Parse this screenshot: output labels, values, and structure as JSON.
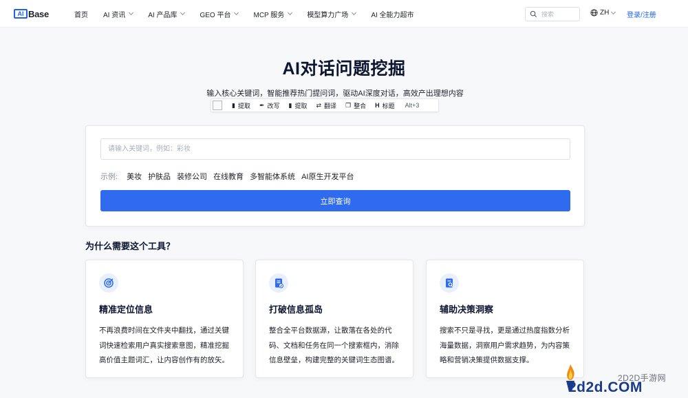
{
  "nav": {
    "logo_mark": "AI",
    "logo_text": "Base",
    "menu": [
      {
        "label": "首页",
        "has_dropdown": false
      },
      {
        "label": "AI 资讯",
        "has_dropdown": true
      },
      {
        "label": "AI 产品库",
        "has_dropdown": true
      },
      {
        "label": "GEO 平台",
        "has_dropdown": true
      },
      {
        "label": "MCP 服务",
        "has_dropdown": true
      },
      {
        "label": "模型算力广场",
        "has_dropdown": true
      },
      {
        "label": "AI 全能力超市",
        "has_dropdown": false
      }
    ],
    "search_placeholder": "搜索",
    "lang": "ZH",
    "login": "登录/注册"
  },
  "hero": {
    "title": "AI对话问题挖掘",
    "subtitle": "输入核心关键词，智能推荐热门提问词，驱动AI深度对话，高效产出理想内容"
  },
  "toolbar": {
    "items": [
      {
        "icon": "document-icon",
        "label": "提取"
      },
      {
        "icon": "pen-icon",
        "label": "改写"
      },
      {
        "icon": "document-icon",
        "label": "提取"
      },
      {
        "icon": "translate-icon",
        "label": "翻译"
      },
      {
        "icon": "merge-icon",
        "label": "整合"
      },
      {
        "icon": "heading-icon",
        "label": "标题"
      }
    ],
    "shortcut": "Alt+3"
  },
  "query": {
    "placeholder": "请输入关键词，例如：彩妆",
    "examples_label": "示例:",
    "examples": [
      "美妆",
      "护肤品",
      "装修公司",
      "在线教育",
      "多智能体系统",
      "AI原生开发平台"
    ],
    "submit_label": "立即查询"
  },
  "why": {
    "title": "为什么需要这个工具？",
    "features": [
      {
        "icon": "target-icon",
        "title": "精准定位信息",
        "desc": "不再浪费时间在文件夹中翻找，通过关键词快速检索用户真实搜索意图，精准挖掘高价值主题词汇，让内容创作有的放矢。"
      },
      {
        "icon": "checklist-icon",
        "title": "打破信息孤岛",
        "desc": "整合全平台数据源，让散落在各处的代码、文档和任务在同一个搜索框内，消除信息壁垒，构建完整的关键词生态图谱。"
      },
      {
        "icon": "search-document-icon",
        "title": "辅助决策洞察",
        "desc": "搜索不只是寻找，更是通过热度指数分析海量数据，洞察用户需求趋势，为内容策略和营销决策提供数据支撑。"
      }
    ]
  },
  "watermark": {
    "top": "2D2D手游网",
    "bottom": "2d2d.COM"
  },
  "colors": {
    "accent": "#2f6bef",
    "title": "#0d1530",
    "icon_bg": "#e8effd"
  }
}
